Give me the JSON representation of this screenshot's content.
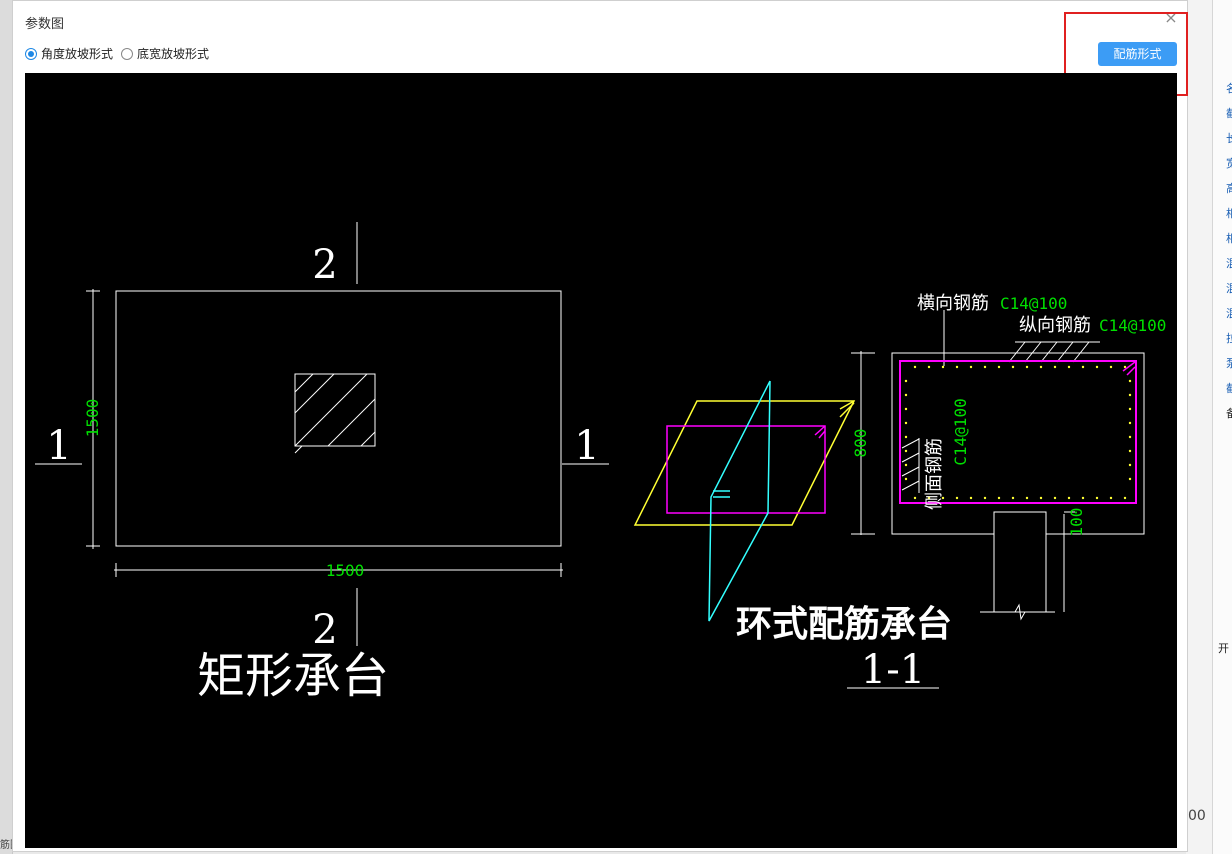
{
  "dialog": {
    "title": "参数图",
    "close_symbol": "×",
    "radio_options": [
      {
        "label": "角度放坡形式",
        "checked": true
      },
      {
        "label": "底宽放坡形式",
        "checked": false
      }
    ],
    "rebar_button_label": "配筋形式"
  },
  "drawing": {
    "left_figure": {
      "section_mark_2": "2",
      "section_mark_1": "1",
      "height_dim": "1500",
      "width_dim": "1500",
      "title": "矩形承台"
    },
    "right_figure": {
      "title": "环式配筋承台",
      "section_label": "1-1",
      "transverse_label": "横向钢筋",
      "transverse_spec": "C14@100",
      "longitudinal_label": "纵向钢筋",
      "longitudinal_spec": "C14@100",
      "side_label": "侧面钢筋",
      "side_spec": "C14@100",
      "height_dim": "800",
      "cover_dim": "100"
    }
  },
  "colors": {
    "canvas": "#000000",
    "line": "#ffffff",
    "dimension_text": "#00e000",
    "rebar_magenta": "#ff00ff",
    "rebar_yellow": "#ffff33",
    "rebar_cyan": "#33ffff",
    "button_blue": "#3c9cf5",
    "highlight_red": "#e02020"
  },
  "background_app": {
    "right_panel_chars": [
      "名",
      "截",
      "长",
      "宽",
      "高",
      "相",
      "相",
      "混",
      "混",
      "混",
      "拉",
      "泵",
      "截",
      "备",
      "开"
    ],
    "bottom_left_text": "筋图",
    "bottom_right_text": "00"
  }
}
